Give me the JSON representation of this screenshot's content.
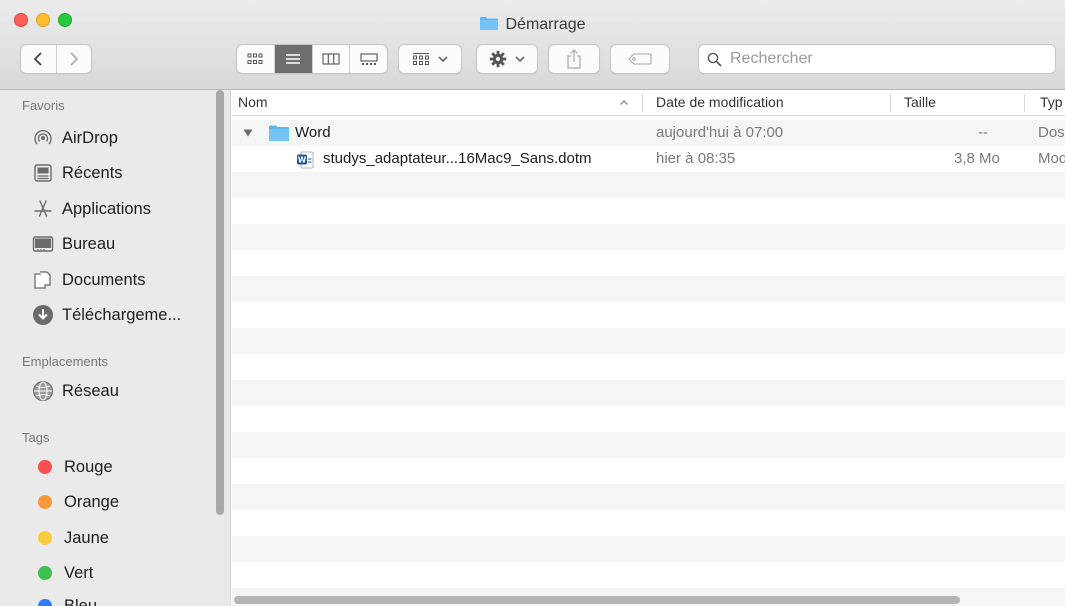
{
  "window": {
    "title": "Démarrage"
  },
  "search": {
    "placeholder": "Rechercher"
  },
  "sidebar": {
    "favorites_heading": "Favoris",
    "favorites": [
      {
        "label": "AirDrop",
        "icon": "airdrop-icon"
      },
      {
        "label": "Récents",
        "icon": "recents-icon"
      },
      {
        "label": "Applications",
        "icon": "applications-icon"
      },
      {
        "label": "Bureau",
        "icon": "desktop-icon"
      },
      {
        "label": "Documents",
        "icon": "documents-icon"
      },
      {
        "label": "Téléchargeme...",
        "icon": "downloads-icon"
      }
    ],
    "locations_heading": "Emplacements",
    "locations": [
      {
        "label": "Réseau",
        "icon": "network-icon"
      }
    ],
    "tags_heading": "Tags",
    "tags": [
      {
        "label": "Rouge",
        "color": "#fc4f4f"
      },
      {
        "label": "Orange",
        "color": "#f7983a"
      },
      {
        "label": "Jaune",
        "color": "#f8cc3a"
      },
      {
        "label": "Vert",
        "color": "#3ec24f"
      },
      {
        "label": "Bleu",
        "color": "#2f7cf6"
      }
    ]
  },
  "columns": {
    "name": "Nom",
    "date": "Date de modification",
    "size": "Taille",
    "kind": "Typ"
  },
  "rows": [
    {
      "name": "Word",
      "date": "aujourd'hui à 07:00",
      "size": "--",
      "kind": "Dos",
      "icon": "folder-icon"
    },
    {
      "name": "studys_adaptateur...16Mac9_Sans.dotm",
      "date": "hier à 08:35",
      "size": "3,8 Mo",
      "kind": "Mod",
      "icon": "word-document-icon"
    }
  ],
  "colors": {
    "accent": "#2f7cf6",
    "folder": "#5eb6ef"
  }
}
